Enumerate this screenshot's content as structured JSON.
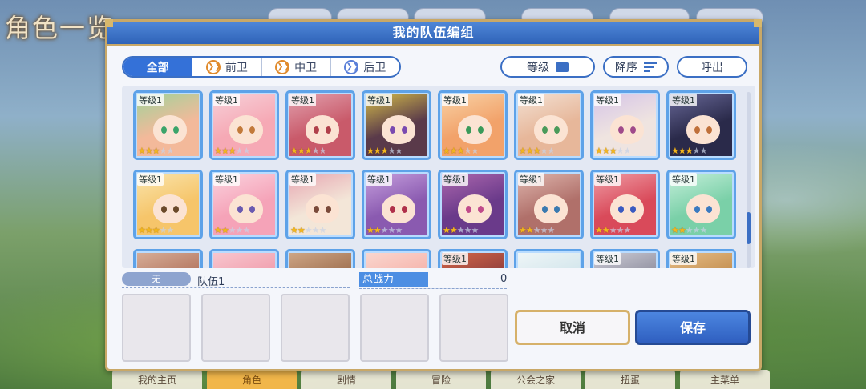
{
  "background": {
    "title": "角色一览",
    "nav": [
      "我的主页",
      "角色",
      "剧情",
      "冒险",
      "公会之家",
      "扭蛋",
      "主菜单"
    ],
    "nav_active": 1
  },
  "dialog": {
    "title": "我的队伍编组",
    "tabs": [
      {
        "label": "全部",
        "active": true
      },
      {
        "label": "前卫",
        "icon": "vanguard-chevron-icon"
      },
      {
        "label": "中卫",
        "icon": "midguard-chevron-icon"
      },
      {
        "label": "后卫",
        "icon": "rearguard-chevron-icon"
      }
    ],
    "sort_key_label": "等级",
    "sort_order_label": "降序",
    "call_label": "呼出",
    "cards": [
      {
        "level": "等级1",
        "stars": 3,
        "palette": [
          "#f3b99a",
          "#9cd49a"
        ],
        "eye": "#3ba46a"
      },
      {
        "level": "等级1",
        "stars": 3,
        "palette": [
          "#f6a9b5",
          "#f7d2da"
        ],
        "eye": "#c27a3a"
      },
      {
        "level": "等级1",
        "stars": 3,
        "palette": [
          "#c95a6a",
          "#e2a3b0"
        ],
        "eye": "#b0404a"
      },
      {
        "level": "等级1",
        "stars": 3,
        "palette": [
          "#5a3a4a",
          "#d9c24a"
        ],
        "eye": "#7a4ab0"
      },
      {
        "level": "等级1",
        "stars": 3,
        "palette": [
          "#f2a26a",
          "#f8d4a8"
        ],
        "eye": "#3a9a5a"
      },
      {
        "level": "等级1",
        "stars": 3,
        "palette": [
          "#e7b79a",
          "#f3e2d5"
        ],
        "eye": "#4a9a5a"
      },
      {
        "level": "等级1",
        "stars": 3,
        "palette": [
          "#efe4e0",
          "#d4c3e8"
        ],
        "eye": "#a04a8a"
      },
      {
        "level": "等级1",
        "stars": 3,
        "palette": [
          "#2a2a4a",
          "#6a6a9a"
        ],
        "eye": "#c0703a"
      },
      {
        "level": "等级1",
        "stars": 3,
        "palette": [
          "#f6c56a",
          "#f9e6b0"
        ],
        "eye": "#6a4a2a"
      },
      {
        "level": "等级1",
        "stars": 2,
        "palette": [
          "#f5a3b8",
          "#fbd5e0"
        ],
        "eye": "#6a5ab0"
      },
      {
        "level": "等级1",
        "stars": 2,
        "palette": [
          "#f3e6d8",
          "#e6a3b0"
        ],
        "eye": "#7a4a3a"
      },
      {
        "level": "等级1",
        "stars": 2,
        "palette": [
          "#8a5ab0",
          "#c9a3e0"
        ],
        "eye": "#b0304a"
      },
      {
        "level": "等级1",
        "stars": 2,
        "palette": [
          "#6a3a8a",
          "#b06ab0"
        ],
        "eye": "#c04a8a"
      },
      {
        "level": "等级1",
        "stars": 2,
        "palette": [
          "#b0706a",
          "#e0b8b0"
        ],
        "eye": "#3a7ab0"
      },
      {
        "level": "等级1",
        "stars": 2,
        "palette": [
          "#d94a5a",
          "#f0a0a8"
        ],
        "eye": "#3a5ac0"
      },
      {
        "level": "等级1",
        "stars": 2,
        "palette": [
          "#7ad0a8",
          "#c8f0dc"
        ],
        "eye": "#3a7ac0"
      },
      {
        "level": "",
        "stars": 0,
        "palette": [
          "#b0705a",
          "#d8b09a"
        ],
        "eye": "#3a5a8a"
      },
      {
        "level": "",
        "stars": 0,
        "palette": [
          "#f09aaa",
          "#f8c8d0"
        ],
        "eye": "#3a5a8a"
      },
      {
        "level": "",
        "stars": 0,
        "palette": [
          "#9a6a4a",
          "#d0a888"
        ],
        "eye": "#3a5a8a"
      },
      {
        "level": "",
        "stars": 0,
        "palette": [
          "#f5b0a8",
          "#fad8d0"
        ],
        "eye": "#3a5a8a"
      },
      {
        "level": "等级1",
        "stars": 0,
        "palette": [
          "#8a3a3a",
          "#d86a4a"
        ],
        "eye": "#3a5a8a"
      },
      {
        "level": "",
        "stars": 0,
        "palette": [
          "#cfe4ea",
          "#f0f6f8"
        ],
        "eye": "#3a5a8a"
      },
      {
        "level": "等级1",
        "stars": 0,
        "palette": [
          "#8a8a9a",
          "#d0d0da"
        ],
        "eye": "#3a5a8a"
      },
      {
        "level": "等级1",
        "stars": 0,
        "palette": [
          "#c08a4a",
          "#e8c08a"
        ],
        "eye": "#3a5a8a"
      }
    ],
    "team": {
      "badge": "无",
      "name": "队伍1",
      "power_label": "总战力",
      "power_value": "0",
      "slots": 5
    },
    "cancel_label": "取消",
    "save_label": "保存"
  }
}
